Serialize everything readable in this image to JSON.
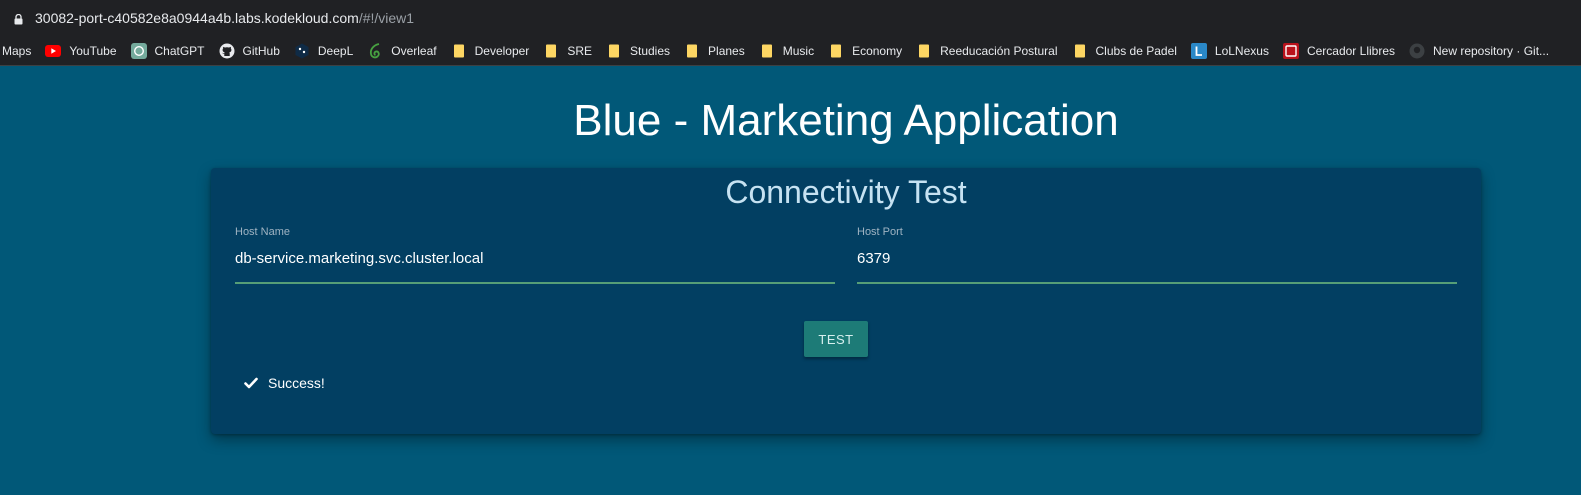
{
  "browser": {
    "url_host": "30082-port-c40582e8a0944a4b.labs.kodekloud.com",
    "url_path": "/#!/view1",
    "bookmarks": [
      {
        "label": "Maps",
        "icon": "none"
      },
      {
        "label": "YouTube",
        "icon": "youtube-icon"
      },
      {
        "label": "ChatGPT",
        "icon": "chatgpt-icon"
      },
      {
        "label": "GitHub",
        "icon": "github-icon"
      },
      {
        "label": "DeepL",
        "icon": "deepl-icon"
      },
      {
        "label": "Overleaf",
        "icon": "overleaf-icon"
      },
      {
        "label": "Developer",
        "icon": "folder-icon"
      },
      {
        "label": "SRE",
        "icon": "folder-icon"
      },
      {
        "label": "Studies",
        "icon": "folder-icon"
      },
      {
        "label": "Planes",
        "icon": "folder-icon"
      },
      {
        "label": "Music",
        "icon": "folder-icon"
      },
      {
        "label": "Economy",
        "icon": "folder-icon"
      },
      {
        "label": "Reeducación Postural",
        "icon": "folder-icon"
      },
      {
        "label": "Clubs de Padel",
        "icon": "folder-icon"
      },
      {
        "label": "LoLNexus",
        "icon": "lolnexus-icon"
      },
      {
        "label": "Cercador Llibres",
        "icon": "cercador-icon"
      },
      {
        "label": "New repository · Git...",
        "icon": "github-icon"
      }
    ]
  },
  "colors": {
    "page_background": "#015878",
    "card_background": "#023f62",
    "button_background": "#1d7b77",
    "input_underline": "#5fa87a"
  },
  "page": {
    "title": "Blue - Marketing Application"
  },
  "card": {
    "title": "Connectivity Test",
    "host_name": {
      "label": "Host Name",
      "value": "db-service.marketing.svc.cluster.local"
    },
    "host_port": {
      "label": "Host Port",
      "value": "6379"
    },
    "test_button_label": "TEST",
    "status_text": "Success!",
    "status_icon": "check-icon"
  }
}
